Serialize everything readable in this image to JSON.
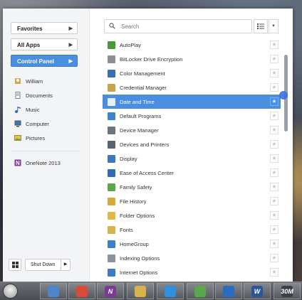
{
  "left_nav": {
    "favorites": "Favorites",
    "all_apps": "All Apps",
    "control_panel": "Control Panel"
  },
  "places": [
    {
      "label": "William",
      "icon": "user-icon"
    },
    {
      "label": "Documents",
      "icon": "documents-icon"
    },
    {
      "label": "Music",
      "icon": "music-icon"
    },
    {
      "label": "Computer",
      "icon": "computer-icon"
    },
    {
      "label": "Pictures",
      "icon": "pictures-icon"
    }
  ],
  "pinned": [
    {
      "label": "OneNote 2013",
      "icon": "onenote-icon"
    }
  ],
  "shutdown": {
    "label": "Shut Down"
  },
  "search": {
    "placeholder": "Search"
  },
  "control_panel_items": [
    {
      "label": "AutoPlay",
      "color": "#4a9a3c"
    },
    {
      "label": "BitLocker Drive Encryption",
      "color": "#8a8f96"
    },
    {
      "label": "Color Management",
      "color": "#3a6fb5"
    },
    {
      "label": "Credential Manager",
      "color": "#c9a44a"
    },
    {
      "label": "Date and Time",
      "color": "#e8eef7",
      "selected": true
    },
    {
      "label": "Default Programs",
      "color": "#3f86c9"
    },
    {
      "label": "Device Manager",
      "color": "#6c7480"
    },
    {
      "label": "Devices and Printers",
      "color": "#5a6470"
    },
    {
      "label": "Display",
      "color": "#3a78c0"
    },
    {
      "label": "Ease of Access Center",
      "color": "#2f6db5"
    },
    {
      "label": "Family Safety",
      "color": "#5aa84a"
    },
    {
      "label": "File History",
      "color": "#d6a93a"
    },
    {
      "label": "Folder Options",
      "color": "#e2b846"
    },
    {
      "label": "Fonts",
      "color": "#d9b24e"
    },
    {
      "label": "HomeGroup",
      "color": "#3e7fc8"
    },
    {
      "label": "Indexing Options",
      "color": "#8c939c"
    },
    {
      "label": "Internet Options",
      "color": "#3a7cc9"
    }
  ],
  "taskbar": {
    "apps": [
      {
        "name": "file-explorer-app",
        "color": "#4a86c8"
      },
      {
        "name": "chrome-app",
        "color": "#d94a38"
      },
      {
        "name": "onenote-app",
        "color": "#7b3a96",
        "label": "N"
      },
      {
        "name": "folder-app",
        "color": "#d9b24e"
      },
      {
        "name": "internet-explorer-app",
        "color": "#2f8fe0"
      },
      {
        "name": "photo-app",
        "color": "#5aa84a"
      },
      {
        "name": "media-app",
        "color": "#2a6cc0"
      },
      {
        "name": "word-app",
        "color": "#2b579a",
        "label": "W"
      },
      {
        "name": "tray-app",
        "color": "#3b3f45",
        "label": "30M"
      }
    ]
  }
}
